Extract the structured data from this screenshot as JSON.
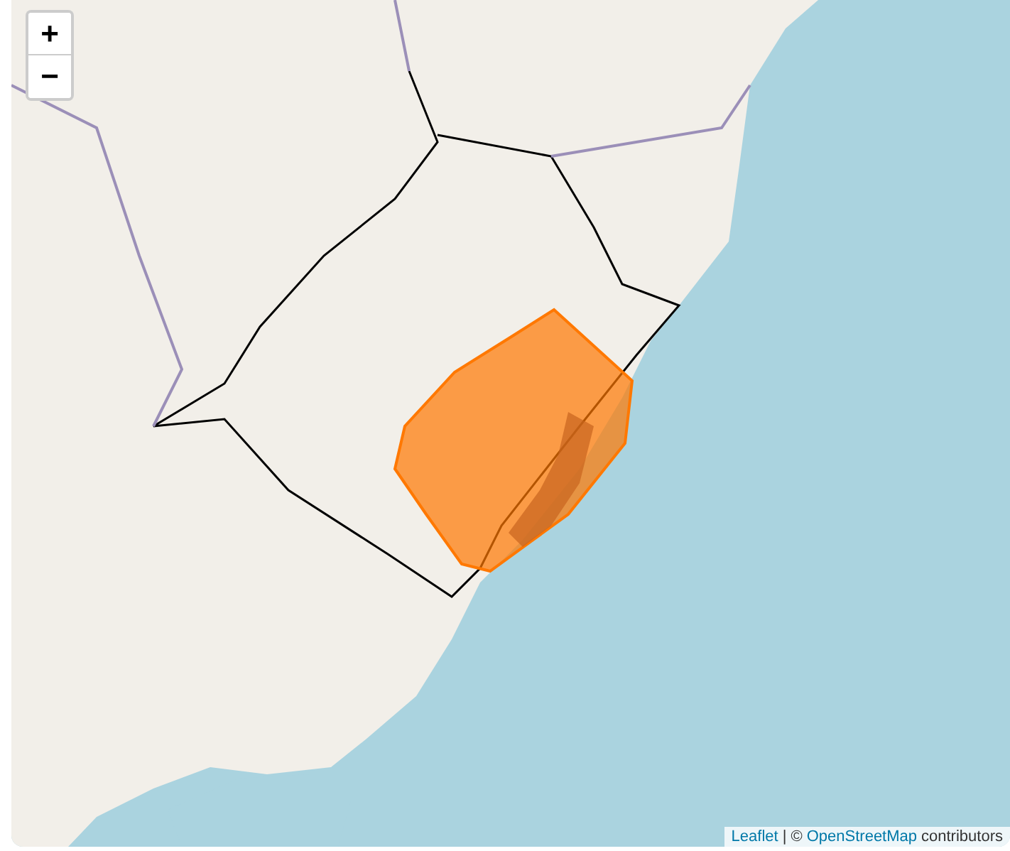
{
  "zoom_controls": [
    {
      "label": "+"
    },
    {
      "label": "−"
    }
  ],
  "attribution": {
    "leaflet_link": "Leaflet",
    "separator": "| ©",
    "osm_link": "OpenStreetMap",
    "suffix": "contributors"
  }
}
